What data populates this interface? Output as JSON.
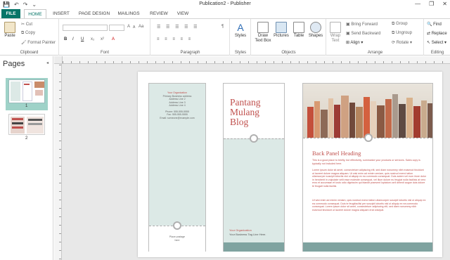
{
  "window": {
    "title": "Publication2 - Publisher",
    "minimize": "—",
    "restore": "❐",
    "close": "✕"
  },
  "quick_access": {
    "save": "💾",
    "undo": "↶",
    "redo": "↷",
    "more": "⌄"
  },
  "tabs": [
    {
      "label": "FILE"
    },
    {
      "label": "HOME"
    },
    {
      "label": "INSERT"
    },
    {
      "label": "PAGE DESIGN"
    },
    {
      "label": "MAILINGS"
    },
    {
      "label": "REVIEW"
    },
    {
      "label": "VIEW"
    }
  ],
  "ribbon": {
    "clipboard": {
      "label": "Clipboard",
      "paste": "Paste",
      "cut": "Cut",
      "copy": "Copy",
      "format_painter": "Format Painter"
    },
    "font": {
      "label": "Font",
      "bold": "B",
      "italic": "I",
      "underline": "U",
      "sub": "x₂",
      "sup": "x²",
      "grow": "A",
      "shrink": "A",
      "case": "Aa",
      "clear": "A"
    },
    "paragraph": {
      "label": "Paragraph",
      "marks": "¶"
    },
    "styles": {
      "label": "Styles",
      "btn": "Styles"
    },
    "objects": {
      "label": "Objects",
      "draw_text_box": "Draw Text Box",
      "pictures": "Pictures",
      "table": "Table",
      "shapes": "Shapes"
    },
    "arrange": {
      "label": "Arrange",
      "wrap_text": "Wrap Text",
      "bring_forward": "Bring Forward",
      "send_backward": "Send Backward",
      "align": "Align",
      "group": "Group",
      "ungroup": "Ungroup",
      "rotate": "Rotate"
    },
    "editing": {
      "label": "Editing",
      "find": "Find",
      "replace": "Replace",
      "select": "Select"
    }
  },
  "pages_panel": {
    "title": "Pages",
    "page1": "1",
    "page2": "2"
  },
  "doc": {
    "panel1": {
      "org": "Your Organization",
      "address": [
        "Primary Business address",
        "Address Line 2",
        "Address Line 3",
        "Address Line 4"
      ],
      "phone": "Phone: 555-555-5555",
      "fax": "Fax: 555-555-5555",
      "email": "Email: someone@example.com",
      "stamp": "Place postage here"
    },
    "panel2": {
      "title": "Pantang Mulang Blog",
      "org": "Your Organization",
      "tagline": "Your Business Tag Line Here."
    },
    "panel3": {
      "heading": "Back Panel Heading",
      "p1": "This is a good place to briefly, but effectively, summarize your products or services. Sales copy is typically not included here.",
      "p2": "Lorem ipsum dolor sit amet, consectetuer adipiscing elit, sed diam nonummy nibh euismod tincidunt ut laoreet dolore magna aliquam. Ut wisi enim ad minim veniam, quis nostrud exerci tation ullamcorper suscipit lobortis nisl ut aliquip ex ea commodo consequat. Duis autem vel eum iriure dolor in hendrerit in vulputate velit esse molestie consequat, vel illum dolore eu feugiat nulla facilisis at vero eros et accumsan et iusto odio dignissim qui blandit praesent luptatum zzril delenit augue duis dolore te feugait nulla facilisi.",
      "p3": "Ut wisi enim ad minim veniam, quis nostrud exerci tation ullamcorper suscipit lobortis nisl ut aliquip ex ea commodo consequat. Duis te feugifacilisi per suscipit lobortis nisl ut aliquip ex ea commodo consequat. Lorem ipsum dolor sit amet, consectetuer adipiscing elit, sed diam nonummy nibh euismod tincidunt ut laoreet dolore magna aliquam erat volutpat."
    }
  },
  "colors": {
    "accent": "#077568",
    "title_red": "#c0504d",
    "panel_tint": "#dce9e6",
    "band": "#7fa3a0"
  }
}
